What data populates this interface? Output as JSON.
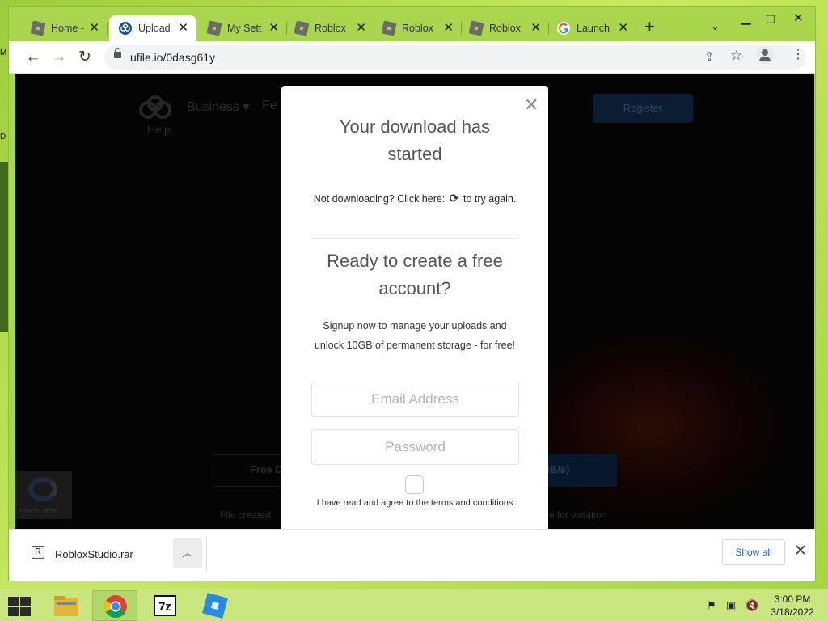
{
  "browser": {
    "tabs": [
      {
        "title": "Home -",
        "favicon": "roblox-icon",
        "active": false
      },
      {
        "title": "Upload",
        "favicon": "ufile-icon",
        "active": true
      },
      {
        "title": "My Sett",
        "favicon": "roblox-icon",
        "active": false
      },
      {
        "title": "Roblox",
        "favicon": "roblox-icon",
        "active": false
      },
      {
        "title": "Roblox",
        "favicon": "roblox-icon",
        "active": false
      },
      {
        "title": "Roblox",
        "favicon": "roblox-icon",
        "active": false
      },
      {
        "title": "Launch",
        "favicon": "google-icon",
        "active": false
      }
    ],
    "url": "ufile.io/0dasg61y"
  },
  "page": {
    "nav": {
      "business": "Business ▾",
      "features": "Fe",
      "help": "Help",
      "register": "Register"
    },
    "free_download": "Free D",
    "speed_suffix": "MB/s)",
    "file_created": "File created:",
    "report": "e for violation",
    "recaptcha": "Privacy - Terms"
  },
  "modal": {
    "heading": "Your download has started",
    "retry_before": "Not downloading? Click here:",
    "retry_after": "to try again.",
    "signup_heading": "Ready to create a free account?",
    "signup_body_1": "Signup now to manage your uploads and",
    "signup_body_2": "unlock 10GB of permanent storage - for free!",
    "email_placeholder": "Email Address",
    "password_placeholder": "Password",
    "terms": "I have read and agree to the terms and conditions"
  },
  "downloads": {
    "file_name": "RobloxStudio.rar",
    "show_all": "Show all"
  },
  "taskbar": {
    "time": "3:00 PM",
    "date": "3/18/2022",
    "apps": [
      "file-explorer-icon",
      "chrome-icon",
      "7zip-icon",
      "roblox-studio-icon"
    ]
  },
  "colors": {
    "accent_green": "#a9d64c",
    "link_blue": "#1a5fb4"
  }
}
